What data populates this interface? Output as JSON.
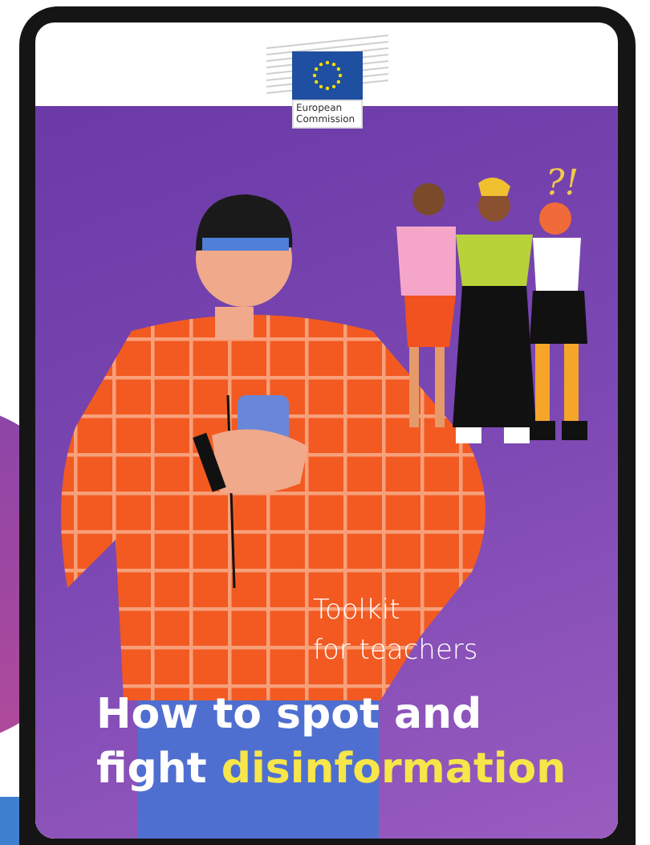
{
  "logo": {
    "lines": [
      "European",
      "Commission"
    ]
  },
  "cover": {
    "exclamation": "?!",
    "subtitle_lines": [
      "Toolkit",
      "for teachers"
    ],
    "title_line_1": "How to spot and",
    "title_line_2": {
      "text": "fight",
      "highlight": "disinformation"
    }
  }
}
